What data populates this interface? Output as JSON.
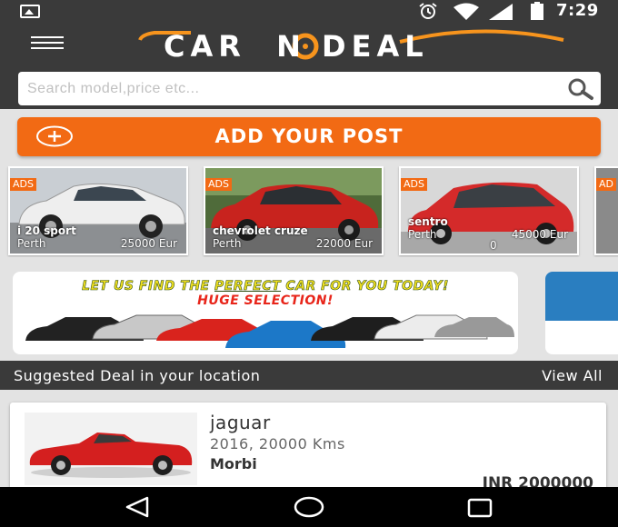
{
  "status_bar": {
    "time": "7:29",
    "icons": [
      "image-icon",
      "alarm-icon",
      "wifi-icon",
      "signal-icon",
      "battery-icon"
    ]
  },
  "app": {
    "logo_parts": [
      "CAR",
      "O",
      "N",
      " DEAL"
    ],
    "menu_icon": "hamburger-menu-icon"
  },
  "search": {
    "placeholder": "Search model,price etc...",
    "value": "",
    "icon": "search-icon"
  },
  "add_post": {
    "label": "ADD YOUR POST",
    "icon": "plus-circle-icon"
  },
  "featured": [
    {
      "badge": "ADS",
      "name": "i 20 sport",
      "location": "Perth",
      "price": "25000 Eur",
      "car_color": "#e8e8e8"
    },
    {
      "badge": "ADS",
      "name": "chevrolet cruze",
      "location": "Perth",
      "price": "22000 Eur",
      "car_color": "#c8231e"
    },
    {
      "badge": "ADS",
      "name": "sentro",
      "location": "Perth",
      "price": "45000 Eur",
      "price_extra": "0",
      "car_color": "#d42a2a"
    },
    {
      "badge": "AD",
      "name": "",
      "location": "",
      "price": "",
      "car_color": "#7a7a7a"
    }
  ],
  "banner": {
    "line1_before": "LET US FIND THE ",
    "line1_emph": "PERFECT",
    "line1_after": " CAR FOR YOU TODAY!",
    "line2": "HUGE SELECTION!"
  },
  "section": {
    "title": "Suggested Deal in your location",
    "view_all": "View All"
  },
  "deals": [
    {
      "name": "jaguar",
      "meta": "2016, 20000 Kms",
      "city": "Morbi",
      "price": "INR 2000000"
    }
  ],
  "colors": {
    "accent": "#f26a14",
    "dark": "#3a3a3a",
    "logo_orange": "#f7941d"
  },
  "nav": {
    "icons": [
      "back-icon",
      "home-icon",
      "recents-icon"
    ]
  }
}
